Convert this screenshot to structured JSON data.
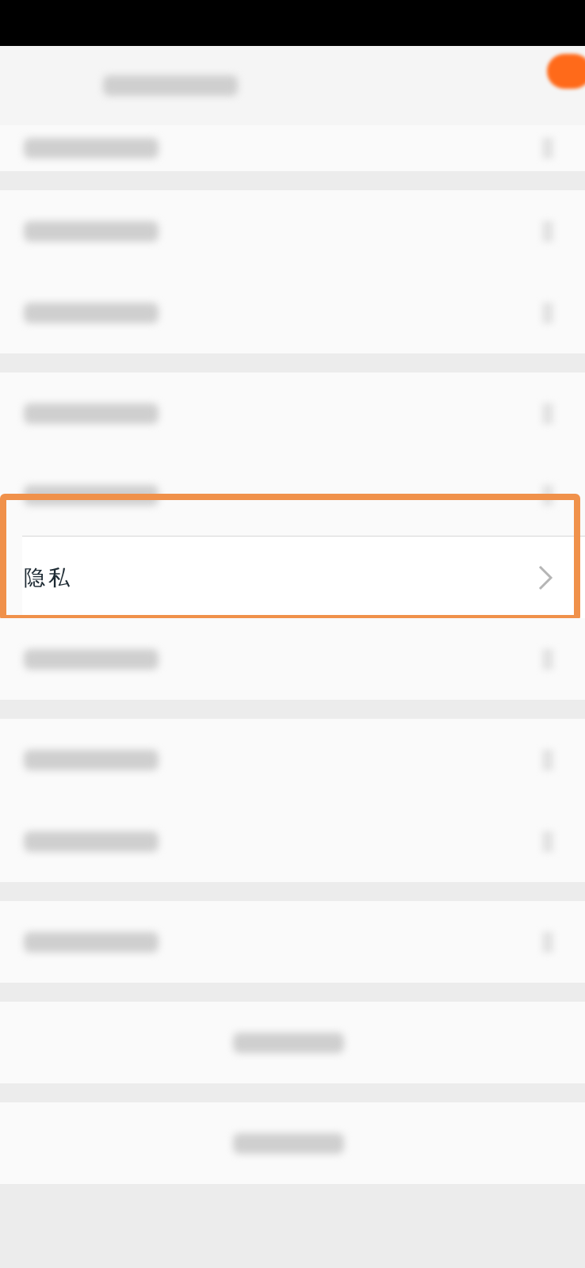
{
  "header": {
    "kind": "blurred"
  },
  "sections": [
    {
      "partial": true,
      "rows": [
        {
          "kind": "blurred",
          "highlighted": false
        }
      ]
    },
    {
      "partial": false,
      "rows": [
        {
          "kind": "blurred",
          "highlighted": false
        },
        {
          "kind": "blurred",
          "highlighted": false
        }
      ]
    },
    {
      "partial": false,
      "rows": [
        {
          "kind": "blurred",
          "highlighted": false
        },
        {
          "kind": "blurred",
          "highlighted": false
        },
        {
          "kind": "label",
          "label": "隐私",
          "highlighted": true
        },
        {
          "kind": "blurred",
          "highlighted": false
        }
      ]
    },
    {
      "partial": false,
      "rows": [
        {
          "kind": "blurred",
          "highlighted": false
        },
        {
          "kind": "blurred",
          "highlighted": false
        }
      ]
    },
    {
      "partial": false,
      "rows": [
        {
          "kind": "blurred",
          "highlighted": false
        }
      ]
    },
    {
      "partial": false,
      "rows": [
        {
          "kind": "centered-blurred",
          "highlighted": false
        }
      ]
    },
    {
      "partial": false,
      "rows": [
        {
          "kind": "centered-blurred",
          "highlighted": false
        }
      ]
    }
  ]
}
